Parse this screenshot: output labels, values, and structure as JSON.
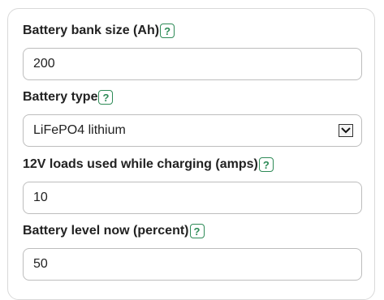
{
  "form": {
    "help_label": "?",
    "fields": [
      {
        "label": "Battery bank size (Ah)",
        "value": "200"
      },
      {
        "label": "Battery type",
        "value": "LiFePO4 lithium"
      },
      {
        "label": "12V loads used while charging (amps)",
        "value": "10"
      },
      {
        "label": "Battery level now (percent)",
        "value": "50"
      }
    ]
  },
  "icons": {
    "help": "question-mark-icon",
    "dropdown": "chevron-down-icon"
  },
  "colors": {
    "accent": "#2e8b57",
    "border": "#bdbdbd"
  }
}
